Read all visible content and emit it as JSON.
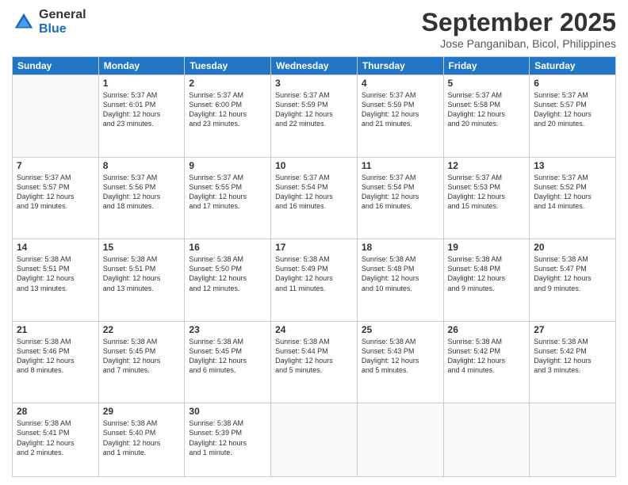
{
  "logo": {
    "general": "General",
    "blue": "Blue"
  },
  "title": "September 2025",
  "subtitle": "Jose Panganiban, Bicol, Philippines",
  "weekdays": [
    "Sunday",
    "Monday",
    "Tuesday",
    "Wednesday",
    "Thursday",
    "Friday",
    "Saturday"
  ],
  "weeks": [
    [
      {
        "day": "",
        "info": ""
      },
      {
        "day": "1",
        "info": "Sunrise: 5:37 AM\nSunset: 6:01 PM\nDaylight: 12 hours\nand 23 minutes."
      },
      {
        "day": "2",
        "info": "Sunrise: 5:37 AM\nSunset: 6:00 PM\nDaylight: 12 hours\nand 23 minutes."
      },
      {
        "day": "3",
        "info": "Sunrise: 5:37 AM\nSunset: 5:59 PM\nDaylight: 12 hours\nand 22 minutes."
      },
      {
        "day": "4",
        "info": "Sunrise: 5:37 AM\nSunset: 5:59 PM\nDaylight: 12 hours\nand 21 minutes."
      },
      {
        "day": "5",
        "info": "Sunrise: 5:37 AM\nSunset: 5:58 PM\nDaylight: 12 hours\nand 20 minutes."
      },
      {
        "day": "6",
        "info": "Sunrise: 5:37 AM\nSunset: 5:57 PM\nDaylight: 12 hours\nand 20 minutes."
      }
    ],
    [
      {
        "day": "7",
        "info": "Sunrise: 5:37 AM\nSunset: 5:57 PM\nDaylight: 12 hours\nand 19 minutes."
      },
      {
        "day": "8",
        "info": "Sunrise: 5:37 AM\nSunset: 5:56 PM\nDaylight: 12 hours\nand 18 minutes."
      },
      {
        "day": "9",
        "info": "Sunrise: 5:37 AM\nSunset: 5:55 PM\nDaylight: 12 hours\nand 17 minutes."
      },
      {
        "day": "10",
        "info": "Sunrise: 5:37 AM\nSunset: 5:54 PM\nDaylight: 12 hours\nand 16 minutes."
      },
      {
        "day": "11",
        "info": "Sunrise: 5:37 AM\nSunset: 5:54 PM\nDaylight: 12 hours\nand 16 minutes."
      },
      {
        "day": "12",
        "info": "Sunrise: 5:37 AM\nSunset: 5:53 PM\nDaylight: 12 hours\nand 15 minutes."
      },
      {
        "day": "13",
        "info": "Sunrise: 5:37 AM\nSunset: 5:52 PM\nDaylight: 12 hours\nand 14 minutes."
      }
    ],
    [
      {
        "day": "14",
        "info": "Sunrise: 5:38 AM\nSunset: 5:51 PM\nDaylight: 12 hours\nand 13 minutes."
      },
      {
        "day": "15",
        "info": "Sunrise: 5:38 AM\nSunset: 5:51 PM\nDaylight: 12 hours\nand 13 minutes."
      },
      {
        "day": "16",
        "info": "Sunrise: 5:38 AM\nSunset: 5:50 PM\nDaylight: 12 hours\nand 12 minutes."
      },
      {
        "day": "17",
        "info": "Sunrise: 5:38 AM\nSunset: 5:49 PM\nDaylight: 12 hours\nand 11 minutes."
      },
      {
        "day": "18",
        "info": "Sunrise: 5:38 AM\nSunset: 5:48 PM\nDaylight: 12 hours\nand 10 minutes."
      },
      {
        "day": "19",
        "info": "Sunrise: 5:38 AM\nSunset: 5:48 PM\nDaylight: 12 hours\nand 9 minutes."
      },
      {
        "day": "20",
        "info": "Sunrise: 5:38 AM\nSunset: 5:47 PM\nDaylight: 12 hours\nand 9 minutes."
      }
    ],
    [
      {
        "day": "21",
        "info": "Sunrise: 5:38 AM\nSunset: 5:46 PM\nDaylight: 12 hours\nand 8 minutes."
      },
      {
        "day": "22",
        "info": "Sunrise: 5:38 AM\nSunset: 5:45 PM\nDaylight: 12 hours\nand 7 minutes."
      },
      {
        "day": "23",
        "info": "Sunrise: 5:38 AM\nSunset: 5:45 PM\nDaylight: 12 hours\nand 6 minutes."
      },
      {
        "day": "24",
        "info": "Sunrise: 5:38 AM\nSunset: 5:44 PM\nDaylight: 12 hours\nand 5 minutes."
      },
      {
        "day": "25",
        "info": "Sunrise: 5:38 AM\nSunset: 5:43 PM\nDaylight: 12 hours\nand 5 minutes."
      },
      {
        "day": "26",
        "info": "Sunrise: 5:38 AM\nSunset: 5:42 PM\nDaylight: 12 hours\nand 4 minutes."
      },
      {
        "day": "27",
        "info": "Sunrise: 5:38 AM\nSunset: 5:42 PM\nDaylight: 12 hours\nand 3 minutes."
      }
    ],
    [
      {
        "day": "28",
        "info": "Sunrise: 5:38 AM\nSunset: 5:41 PM\nDaylight: 12 hours\nand 2 minutes."
      },
      {
        "day": "29",
        "info": "Sunrise: 5:38 AM\nSunset: 5:40 PM\nDaylight: 12 hours\nand 1 minute."
      },
      {
        "day": "30",
        "info": "Sunrise: 5:38 AM\nSunset: 5:39 PM\nDaylight: 12 hours\nand 1 minute."
      },
      {
        "day": "",
        "info": ""
      },
      {
        "day": "",
        "info": ""
      },
      {
        "day": "",
        "info": ""
      },
      {
        "day": "",
        "info": ""
      }
    ]
  ]
}
